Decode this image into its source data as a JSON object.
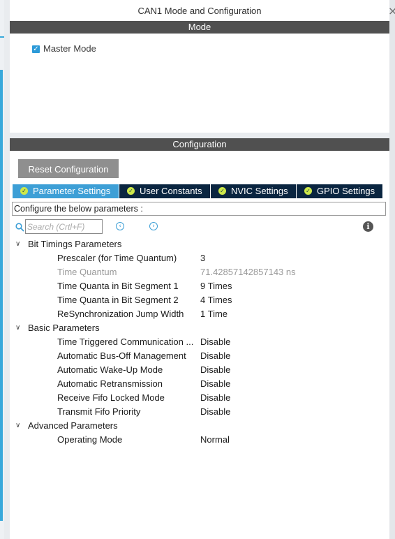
{
  "window": {
    "title": "CAN1 Mode and Configuration",
    "close_glyph": "×"
  },
  "mode": {
    "header": "Mode",
    "master_mode_label": "Master Mode",
    "master_mode_checked": true
  },
  "configuration": {
    "header": "Configuration",
    "reset_label": "Reset Configuration",
    "tabs": [
      {
        "label": "Parameter Settings",
        "active": true
      },
      {
        "label": "User Constants",
        "active": false
      },
      {
        "label": "NVIC Settings",
        "active": false
      },
      {
        "label": "GPIO Settings",
        "active": false
      }
    ],
    "instruction": "Configure the below parameters :",
    "search": {
      "placeholder": "Search (Crtl+F)",
      "value": ""
    },
    "groups": [
      {
        "label": "Bit Timings Parameters",
        "params": [
          {
            "name": "Prescaler (for Time Quantum)",
            "value": "3",
            "readonly": false
          },
          {
            "name": "Time Quantum",
            "value": "71.42857142857143 ns",
            "readonly": true
          },
          {
            "name": "Time Quanta in Bit Segment 1",
            "value": "9 Times",
            "readonly": false
          },
          {
            "name": "Time Quanta in Bit Segment 2",
            "value": "4 Times",
            "readonly": false
          },
          {
            "name": "ReSynchronization Jump Width",
            "value": "1 Time",
            "readonly": false
          }
        ]
      },
      {
        "label": "Basic Parameters",
        "params": [
          {
            "name": "Time Triggered Communication ...",
            "value": "Disable",
            "readonly": false
          },
          {
            "name": "Automatic Bus-Off Management",
            "value": "Disable",
            "readonly": false
          },
          {
            "name": "Automatic Wake-Up Mode",
            "value": "Disable",
            "readonly": false
          },
          {
            "name": "Automatic Retransmission",
            "value": "Disable",
            "readonly": false
          },
          {
            "name": "Receive Fifo Locked Mode",
            "value": "Disable",
            "readonly": false
          },
          {
            "name": "Transmit Fifo Priority",
            "value": "Disable",
            "readonly": false
          }
        ]
      },
      {
        "label": "Advanced Parameters",
        "params": [
          {
            "name": "Operating Mode",
            "value": "Normal",
            "readonly": false
          }
        ]
      }
    ]
  },
  "colors": {
    "section_bar": "#505050",
    "tab_active": "#3d9fd6",
    "tab_inactive": "#0a2540",
    "checkbox": "#2c9ad8",
    "readonly_text": "#9a9a9a"
  },
  "icons": {
    "search": "search-icon",
    "prev": "previous-icon",
    "next": "next-icon",
    "info": "info-icon",
    "collapse": "chevron-down-icon",
    "tab_status": "check-circle-icon"
  }
}
